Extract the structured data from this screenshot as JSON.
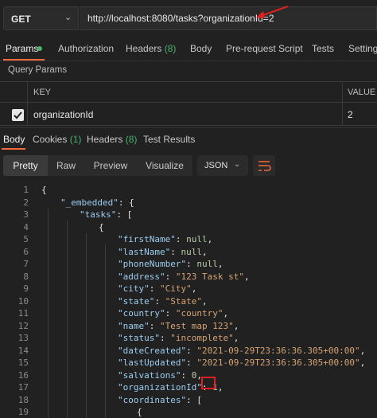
{
  "request": {
    "method": "GET",
    "url": "http://localhost:8080/tasks?organizationId=2"
  },
  "request_tabs": [
    {
      "label": "Params",
      "active": true
    },
    {
      "label": "Authorization"
    },
    {
      "label": "Headers",
      "count": "(8)"
    },
    {
      "label": "Body"
    },
    {
      "label": "Pre-request Script"
    },
    {
      "label": "Tests"
    },
    {
      "label": "Settings"
    }
  ],
  "query_params": {
    "title": "Query Params",
    "key_header": "KEY",
    "value_header": "VALUE",
    "rows": [
      {
        "key": "organizationId",
        "value": "2",
        "checked": true
      }
    ]
  },
  "response_tabs": [
    {
      "label": "Body",
      "active": true
    },
    {
      "label": "Cookies",
      "count": "(1)"
    },
    {
      "label": "Headers",
      "count": "(8)"
    },
    {
      "label": "Test Results"
    }
  ],
  "view_modes": [
    "Pretty",
    "Raw",
    "Preview",
    "Visualize"
  ],
  "active_view": "Pretty",
  "format": "JSON",
  "code_lines": [
    {
      "n": "1",
      "indent": 0,
      "tokens": [
        {
          "t": "{",
          "c": "p"
        }
      ]
    },
    {
      "n": "2",
      "indent": 1,
      "tokens": [
        {
          "t": "\"_embedded\"",
          "c": "k"
        },
        {
          "t": ": {",
          "c": "p"
        }
      ]
    },
    {
      "n": "3",
      "indent": 2,
      "tokens": [
        {
          "t": "\"tasks\"",
          "c": "k"
        },
        {
          "t": ": [",
          "c": "p"
        }
      ]
    },
    {
      "n": "4",
      "indent": 3,
      "tokens": [
        {
          "t": "{",
          "c": "p"
        }
      ]
    },
    {
      "n": "5",
      "indent": 4,
      "tokens": [
        {
          "t": "\"firstName\"",
          "c": "k"
        },
        {
          "t": ": ",
          "c": "p"
        },
        {
          "t": "null",
          "c": "n"
        },
        {
          "t": ",",
          "c": "p"
        }
      ]
    },
    {
      "n": "6",
      "indent": 4,
      "tokens": [
        {
          "t": "\"lastName\"",
          "c": "k"
        },
        {
          "t": ": ",
          "c": "p"
        },
        {
          "t": "null",
          "c": "n"
        },
        {
          "t": ",",
          "c": "p"
        }
      ]
    },
    {
      "n": "7",
      "indent": 4,
      "tokens": [
        {
          "t": "\"phoneNumber\"",
          "c": "k"
        },
        {
          "t": ": ",
          "c": "p"
        },
        {
          "t": "null",
          "c": "n"
        },
        {
          "t": ",",
          "c": "p"
        }
      ]
    },
    {
      "n": "8",
      "indent": 4,
      "tokens": [
        {
          "t": "\"address\"",
          "c": "k"
        },
        {
          "t": ": ",
          "c": "p"
        },
        {
          "t": "\"123 Task st\"",
          "c": "s"
        },
        {
          "t": ",",
          "c": "p"
        }
      ]
    },
    {
      "n": "9",
      "indent": 4,
      "tokens": [
        {
          "t": "\"city\"",
          "c": "k"
        },
        {
          "t": ": ",
          "c": "p"
        },
        {
          "t": "\"City\"",
          "c": "s"
        },
        {
          "t": ",",
          "c": "p"
        }
      ]
    },
    {
      "n": "10",
      "indent": 4,
      "tokens": [
        {
          "t": "\"state\"",
          "c": "k"
        },
        {
          "t": ": ",
          "c": "p"
        },
        {
          "t": "\"State\"",
          "c": "s"
        },
        {
          "t": ",",
          "c": "p"
        }
      ]
    },
    {
      "n": "11",
      "indent": 4,
      "tokens": [
        {
          "t": "\"country\"",
          "c": "k"
        },
        {
          "t": ": ",
          "c": "p"
        },
        {
          "t": "\"country\"",
          "c": "s"
        },
        {
          "t": ",",
          "c": "p"
        }
      ]
    },
    {
      "n": "12",
      "indent": 4,
      "tokens": [
        {
          "t": "\"name\"",
          "c": "k"
        },
        {
          "t": ": ",
          "c": "p"
        },
        {
          "t": "\"Test map 123\"",
          "c": "s"
        },
        {
          "t": ",",
          "c": "p"
        }
      ]
    },
    {
      "n": "13",
      "indent": 4,
      "tokens": [
        {
          "t": "\"status\"",
          "c": "k"
        },
        {
          "t": ": ",
          "c": "p"
        },
        {
          "t": "\"incomplete\"",
          "c": "s"
        },
        {
          "t": ",",
          "c": "p"
        }
      ]
    },
    {
      "n": "14",
      "indent": 4,
      "tokens": [
        {
          "t": "\"dateCreated\"",
          "c": "k"
        },
        {
          "t": ": ",
          "c": "p"
        },
        {
          "t": "\"2021-09-29T23:36:36.305+00:00\"",
          "c": "s"
        },
        {
          "t": ",",
          "c": "p"
        }
      ]
    },
    {
      "n": "15",
      "indent": 4,
      "tokens": [
        {
          "t": "\"lastUpdated\"",
          "c": "k"
        },
        {
          "t": ": ",
          "c": "p"
        },
        {
          "t": "\"2021-09-29T23:36:36.305+00:00\"",
          "c": "s"
        },
        {
          "t": ",",
          "c": "p"
        }
      ]
    },
    {
      "n": "16",
      "indent": 4,
      "tokens": [
        {
          "t": "\"salvations\"",
          "c": "k"
        },
        {
          "t": ": ",
          "c": "p"
        },
        {
          "t": "0",
          "c": "n"
        },
        {
          "t": ",",
          "c": "p"
        }
      ]
    },
    {
      "n": "17",
      "indent": 4,
      "tokens": [
        {
          "t": "\"organizationId\"",
          "c": "k"
        },
        {
          "t": ": ",
          "c": "p"
        },
        {
          "t": "1",
          "c": "n"
        },
        {
          "t": ",",
          "c": "p"
        }
      ]
    },
    {
      "n": "18",
      "indent": 4,
      "tokens": [
        {
          "t": "\"coordinates\"",
          "c": "k"
        },
        {
          "t": ": [",
          "c": "p"
        }
      ]
    },
    {
      "n": "19",
      "indent": 5,
      "tokens": [
        {
          "t": "{",
          "c": "p"
        }
      ]
    }
  ],
  "colors": {
    "accent": "#f26b3a",
    "badge_green": "#49b26a",
    "highlight_red": "#e0201f"
  }
}
